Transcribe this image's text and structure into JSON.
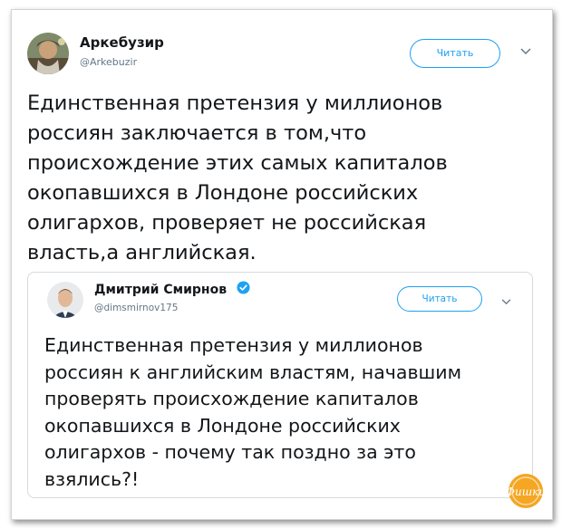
{
  "tweet": {
    "author_name": "Аркебузир",
    "author_handle": "@Arkebuzir",
    "follow_label": "Читать",
    "caret_icon": "chevron-down-icon",
    "lines": [
      "Единственная претензия у миллионов",
      "россиян заключается в том,что",
      "происхождение этих самых капиталов",
      "окопавшихся в Лондоне российских",
      "олигархов, проверяет не российская",
      "власть,а английская."
    ]
  },
  "quoted": {
    "author_name": "Дмитрий Смирнов",
    "author_handle": "@dimsmirnov175",
    "follow_label": "Читать",
    "verified_icon": "verified-badge-icon",
    "lines": [
      "Единственная претензия у миллионов",
      "россиян к английским властям, начавшим",
      "проверять происхождение капиталов",
      "окопавшихся в Лондоне российских",
      "олигархов - почему так поздно за это",
      "взялись?!"
    ]
  },
  "watermark": {
    "logo_icon": "site-logo-icon",
    "text": "Фишки"
  },
  "colors": {
    "accent": "#1da1f2",
    "text": "#14171a",
    "secondary": "#657786",
    "logo": "#f5a623"
  }
}
